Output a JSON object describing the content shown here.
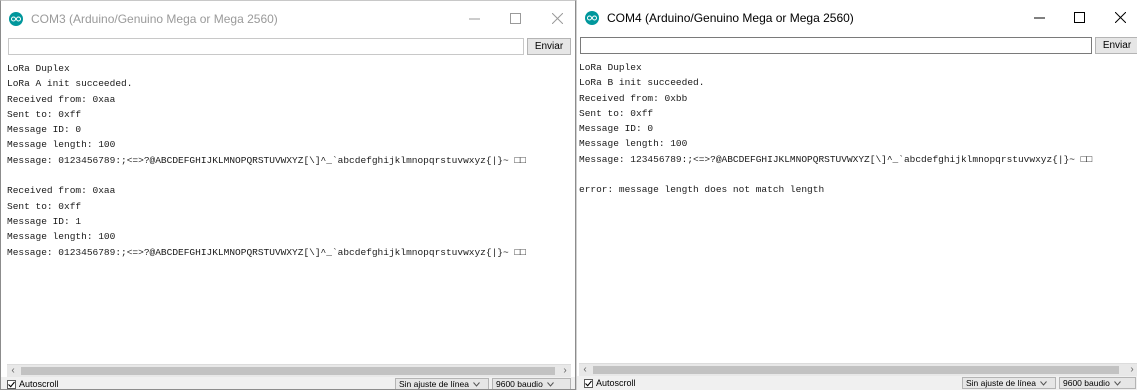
{
  "windows": [
    {
      "title": "COM3 (Arduino/Genuino Mega or Mega 2560)",
      "send_input": "",
      "send_label": "Enviar",
      "lines": [
        "LoRa Duplex",
        "LoRa A init succeeded.",
        "Received from: 0xaa",
        "Sent to: 0xff",
        "Message ID: 0",
        "Message length: 100",
        "Message: 0123456789:;<=>?@ABCDEFGHIJKLMNOPQRSTUVWXYZ[\\]^_`abcdefghijklmnopqrstuvwxyz{|}~ □□",
        "",
        "Received from: 0xaa",
        "Sent to: 0xff",
        "Message ID: 1",
        "Message length: 100",
        "Message: 0123456789:;<=>?@ABCDEFGHIJKLMNOPQRSTUVWXYZ[\\]^_`abcdefghijklmnopqrstuvwxyz{|}~ □□"
      ],
      "autoscroll_label": "Autoscroll",
      "line_ending": "Sin ajuste de línea",
      "baud": "9600 baudio"
    },
    {
      "title": "COM4 (Arduino/Genuino Mega or Mega 2560)",
      "send_input": "",
      "send_label": "Enviar",
      "lines": [
        "LoRa Duplex",
        "LoRa B init succeeded.",
        "Received from: 0xbb",
        "Sent to: 0xff",
        "Message ID: 0",
        "Message length: 100",
        "Message: 123456789:;<=>?@ABCDEFGHIJKLMNOPQRSTUVWXYZ[\\]^_`abcdefghijklmnopqrstuvwxyz{|}~ □□",
        "",
        "error: message length does not match length"
      ],
      "autoscroll_label": "Autoscroll",
      "line_ending": "Sin ajuste de línea",
      "baud": "9600 baudio"
    }
  ],
  "icons": {
    "app": "arduino-logo-icon",
    "minimize": "minimize-icon",
    "maximize": "maximize-icon",
    "close": "close-icon",
    "scroll_left": "scroll-left-arrow-icon",
    "scroll_right": "scroll-right-arrow-icon",
    "checkbox_checked": "checkmark-icon",
    "dropdown": "chevron-down-icon"
  },
  "colors": {
    "arduino_teal": "#00979c",
    "inactive_title": "#9a9a9a",
    "active_title": "#000000",
    "bottom_bar": "#f0f0f0"
  }
}
